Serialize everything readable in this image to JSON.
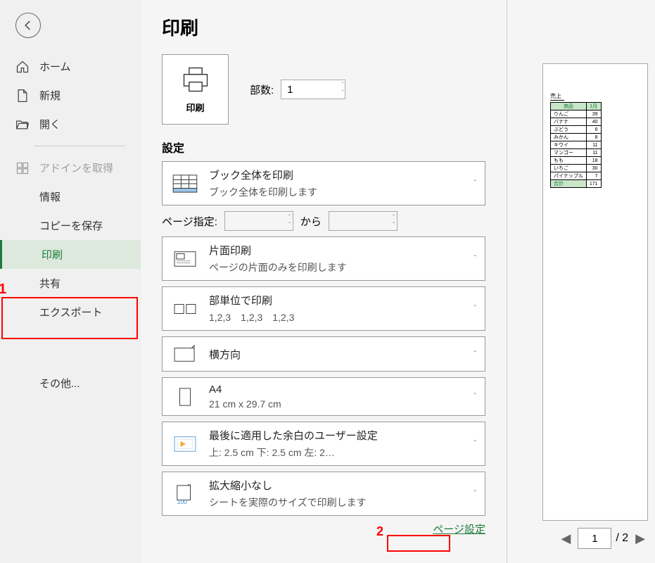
{
  "sidebar": {
    "home": "ホーム",
    "new": "新規",
    "open": "開く",
    "getaddins": "アドインを取得",
    "info": "情報",
    "saveas": "コピーを保存",
    "print": "印刷",
    "share": "共有",
    "export": "エクスポート",
    "more": "その他..."
  },
  "title": "印刷",
  "printBtn": "印刷",
  "copiesLabel": "部数:",
  "copiesValue": "1",
  "settingsTitle": "設定",
  "settings": {
    "what": {
      "label": "ブック全体を印刷",
      "detail": "ブック全体を印刷します"
    },
    "pageFrom": "ページ指定:",
    "pageTo": "から",
    "sides": {
      "label": "片面印刷",
      "detail": "ページの片面のみを印刷します"
    },
    "collate": {
      "label": "部単位で印刷",
      "detail": "1,2,3　1,2,3　1,2,3"
    },
    "orient": {
      "label": "横方向"
    },
    "size": {
      "label": "A4",
      "detail": "21 cm x 29.7 cm"
    },
    "margins": {
      "label": "最後に適用した余白のユーザー設定",
      "detail": "上: 2.5 cm 下: 2.5 cm 左: 2…"
    },
    "scale": {
      "label": "拡大縮小なし",
      "detail": "シートを実際のサイズで印刷します"
    }
  },
  "pageSetupLink": "ページ設定",
  "preview": {
    "tableTitle": "売上",
    "header": [
      "商品",
      "1月"
    ],
    "rows": [
      [
        "りんご",
        "39"
      ],
      [
        "バナナ",
        "40"
      ],
      [
        "ぶどう",
        "6"
      ],
      [
        "みかん",
        "8"
      ],
      [
        "キウイ",
        "11"
      ],
      [
        "マンゴー",
        "11"
      ],
      [
        "もも",
        "18"
      ],
      [
        "いちご",
        "30"
      ],
      [
        "パイナップル",
        "7"
      ],
      [
        "合計",
        "171"
      ]
    ],
    "currentPage": "1",
    "totalPages": "/ 2"
  },
  "annotations": {
    "a1": "1",
    "a2": "2"
  }
}
